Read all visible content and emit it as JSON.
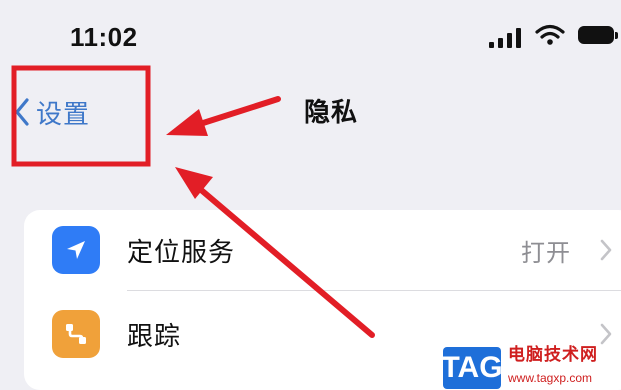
{
  "status_bar": {
    "time": "11:02"
  },
  "nav": {
    "back_label": "设置",
    "title": "隐私"
  },
  "rows": [
    {
      "label": "定位服务",
      "value": "打开",
      "icon": "location-arrow-icon",
      "icon_color": "#2f7cf6"
    },
    {
      "label": "跟踪",
      "value": "",
      "icon": "tracking-icon",
      "icon_color": "#f0a13a"
    }
  ],
  "annotations": {
    "highlight_color": "#e21e26",
    "arrow_color": "#e21e26"
  },
  "watermark": {
    "badge": "TAG",
    "site_name": "电脑技术网",
    "url": "www.tagxp.com"
  }
}
